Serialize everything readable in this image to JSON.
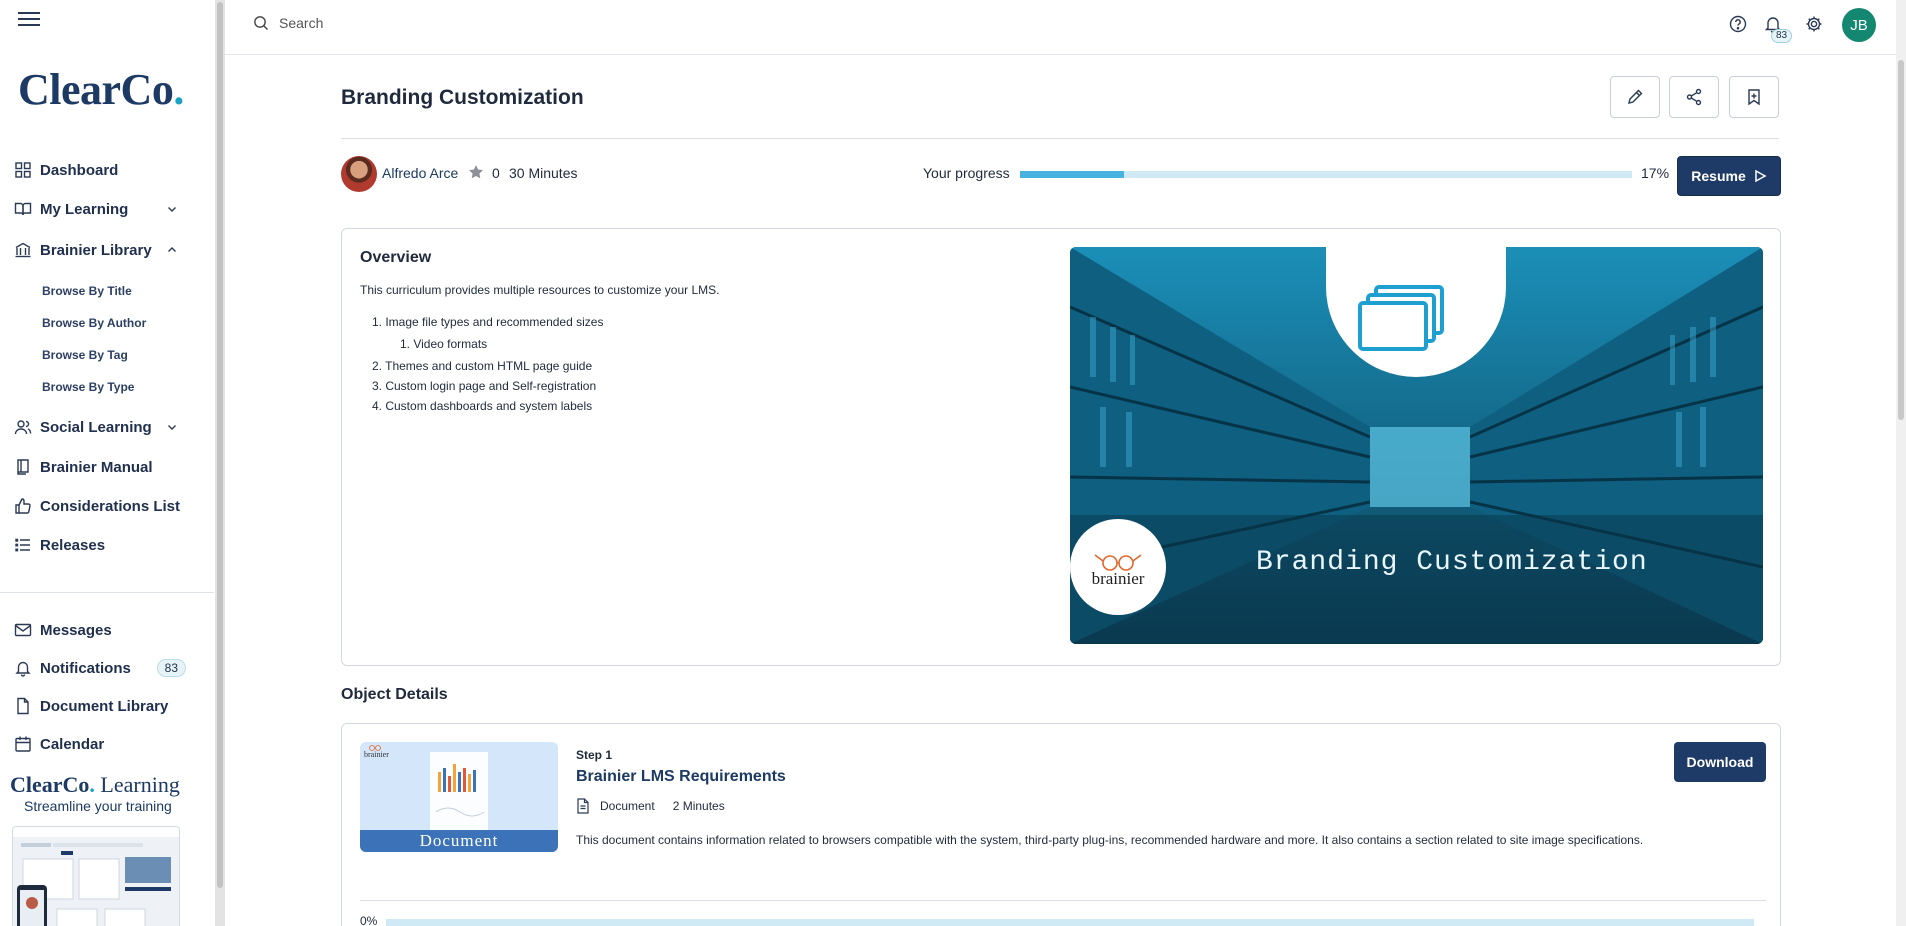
{
  "sidebar": {
    "logo": {
      "text": "ClearCo",
      "dot": "."
    },
    "nav": [
      {
        "label": "Dashboard",
        "icon": "grid-icon"
      },
      {
        "label": "My Learning",
        "icon": "book-open-icon"
      },
      {
        "label": "Brainier Library",
        "icon": "library-icon"
      },
      {
        "label": "Social Learning",
        "icon": "users-icon"
      },
      {
        "label": "Brainier Manual",
        "icon": "manual-icon"
      },
      {
        "label": "Considerations List",
        "icon": "thumbs-up-icon"
      },
      {
        "label": "Releases",
        "icon": "list-icon"
      }
    ],
    "library_sub": [
      "Browse By Title",
      "Browse By Author",
      "Browse By Tag",
      "Browse By Type"
    ],
    "bottom": [
      {
        "label": "Messages",
        "icon": "mail-icon"
      },
      {
        "label": "Notifications",
        "icon": "bell-icon",
        "badge": "83"
      },
      {
        "label": "Document Library",
        "icon": "document-icon"
      },
      {
        "label": "Calendar",
        "icon": "calendar-icon"
      }
    ],
    "promo": {
      "brand": "ClearCo",
      "dot": ".",
      "suffix": " Learning",
      "tagline": "Streamline your training"
    }
  },
  "topbar": {
    "search_placeholder": "Search",
    "notifications_badge": "83",
    "avatar_initials": "JB"
  },
  "course": {
    "title": "Branding Customization",
    "author": "Alfredo Arce",
    "rating": "0",
    "duration": "30 Minutes",
    "progress_label": "Your progress",
    "progress_value": 17,
    "progress_text": "17%",
    "resume_label": "Resume"
  },
  "overview": {
    "title": "Overview",
    "description": "This curriculum provides multiple resources to customize your LMS.",
    "items": [
      {
        "label": "1. Image file types and recommended sizes"
      },
      {
        "label": "1. Video formats"
      },
      {
        "label": "2. Themes and custom HTML page guide"
      },
      {
        "label": "3. Custom login page and Self-registration"
      },
      {
        "label": "4. Custom dashboards and system labels"
      }
    ],
    "image_title": "Branding Customization",
    "image_brand": "brainier"
  },
  "object_details": {
    "title": "Object Details",
    "step": {
      "label": "Step 1",
      "title": "Brainier LMS Requirements",
      "type": "Document",
      "duration": "2 Minutes",
      "description": "This document contains information related to browsers compatible with the system, third-party plug-ins, recommended hardware and more. It also contains a section related to site image specifications.",
      "download_label": "Download",
      "thumb_label": "Document",
      "thumb_brand": "brainier",
      "progress_text": "0%",
      "progress_value": 0
    }
  },
  "colors": {
    "primary": "#1e3a66",
    "accent": "#47b3e0",
    "track": "#cfe9f5",
    "avatar": "#13876f"
  }
}
